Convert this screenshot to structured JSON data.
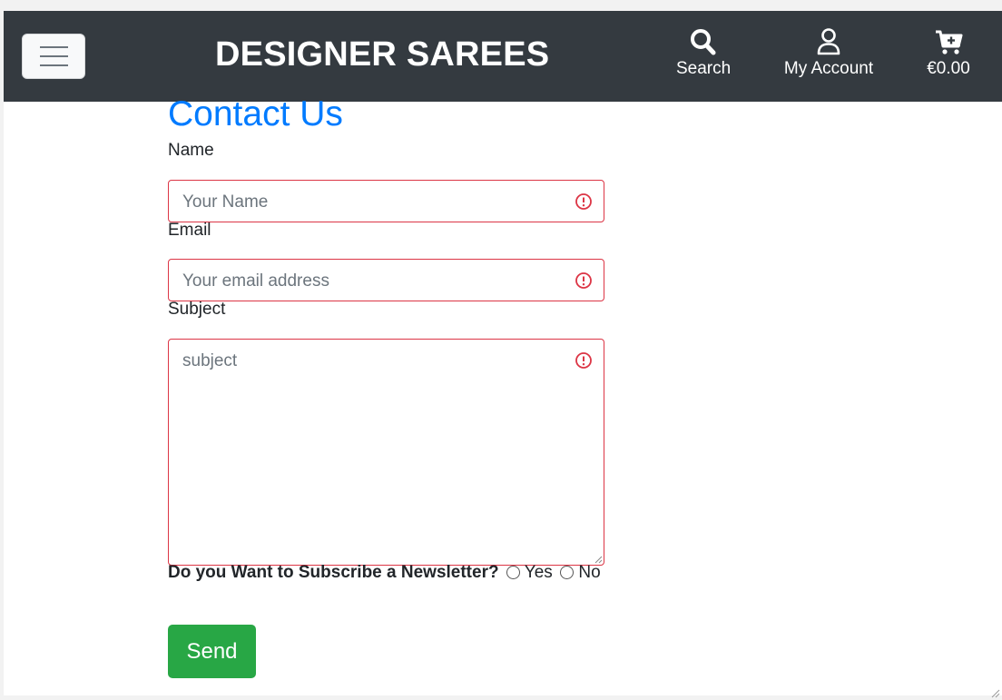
{
  "navbar": {
    "brand": "DESIGNER SAREES",
    "search_label": "Search",
    "account_label": "My Account",
    "cart_total": "€0.00"
  },
  "page": {
    "title": "Contact Us"
  },
  "form": {
    "name_label": "Name",
    "name_placeholder": "Your Name",
    "email_label": "Email",
    "email_placeholder": "Your email address",
    "subject_label": "Subject",
    "subject_placeholder": "subject",
    "newsletter_question": "Do you Want to Subscribe a Newsletter?",
    "yes_label": "Yes",
    "no_label": "No",
    "send_label": "Send"
  },
  "colors": {
    "navbar": "#343a40",
    "title": "#007bff",
    "error": "#dc3545",
    "send": "#28a745"
  },
  "icons": {
    "menu": "hamburger-icon",
    "search": "search-icon",
    "account": "user-icon",
    "cart": "cart-plus-icon",
    "field_error": "exclamation-circle-icon"
  }
}
